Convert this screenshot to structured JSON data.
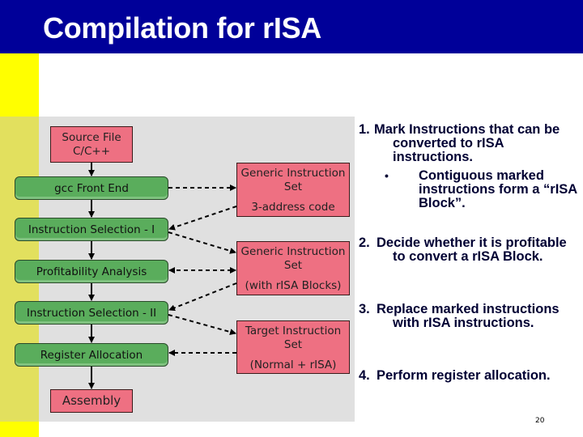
{
  "title": "Compilation for rISA",
  "colors": {
    "header_bg": "#000099",
    "accent_strip": "#ffff00",
    "panel_bg": "#e0e0e0",
    "pink_box": "#ee7082",
    "green_box": "#5aad5c",
    "step_text": "#000033"
  },
  "flow": {
    "left": [
      {
        "id": "source",
        "label": "Source File\nC/C++",
        "line1": "Source File",
        "line2": "C/C++",
        "type": "pink"
      },
      {
        "id": "gcc-front-end",
        "label": "gcc Front End",
        "type": "green"
      },
      {
        "id": "instruction-selection-1",
        "label": "Instruction Selection - I",
        "type": "green"
      },
      {
        "id": "profitability-analysis",
        "label": "Profitability Analysis",
        "type": "green"
      },
      {
        "id": "instruction-selection-2",
        "label": "Instruction Selection - II",
        "type": "green"
      },
      {
        "id": "register-allocation",
        "label": "Register Allocation",
        "type": "green"
      },
      {
        "id": "assembly",
        "label": "Assembly",
        "type": "pink"
      }
    ],
    "middle": [
      {
        "id": "generic-is-1",
        "line1": "Generic Instruction",
        "line2": "Set",
        "sub": "3-address code"
      },
      {
        "id": "generic-is-2",
        "line1": "Generic Instruction",
        "line2": "Set",
        "sub": "(with rISA Blocks)"
      },
      {
        "id": "target-is",
        "line1": "Target Instruction",
        "line2": "Set",
        "sub": "(Normal  + rISA)"
      }
    ]
  },
  "steps": [
    {
      "num": "1.",
      "text": "Mark Instructions that can be converted to rISA instructions.",
      "bullet": "Contiguous marked instructions form a “rISA Block”."
    },
    {
      "num": "2.",
      "text": "Decide whether it is profitable to convert a rISA Block."
    },
    {
      "num": "3.",
      "text": "Replace marked instructions with rISA instructions."
    },
    {
      "num": "4.",
      "text": "Perform register allocation."
    }
  ],
  "bullet_glyph": "•",
  "page_number": "20"
}
